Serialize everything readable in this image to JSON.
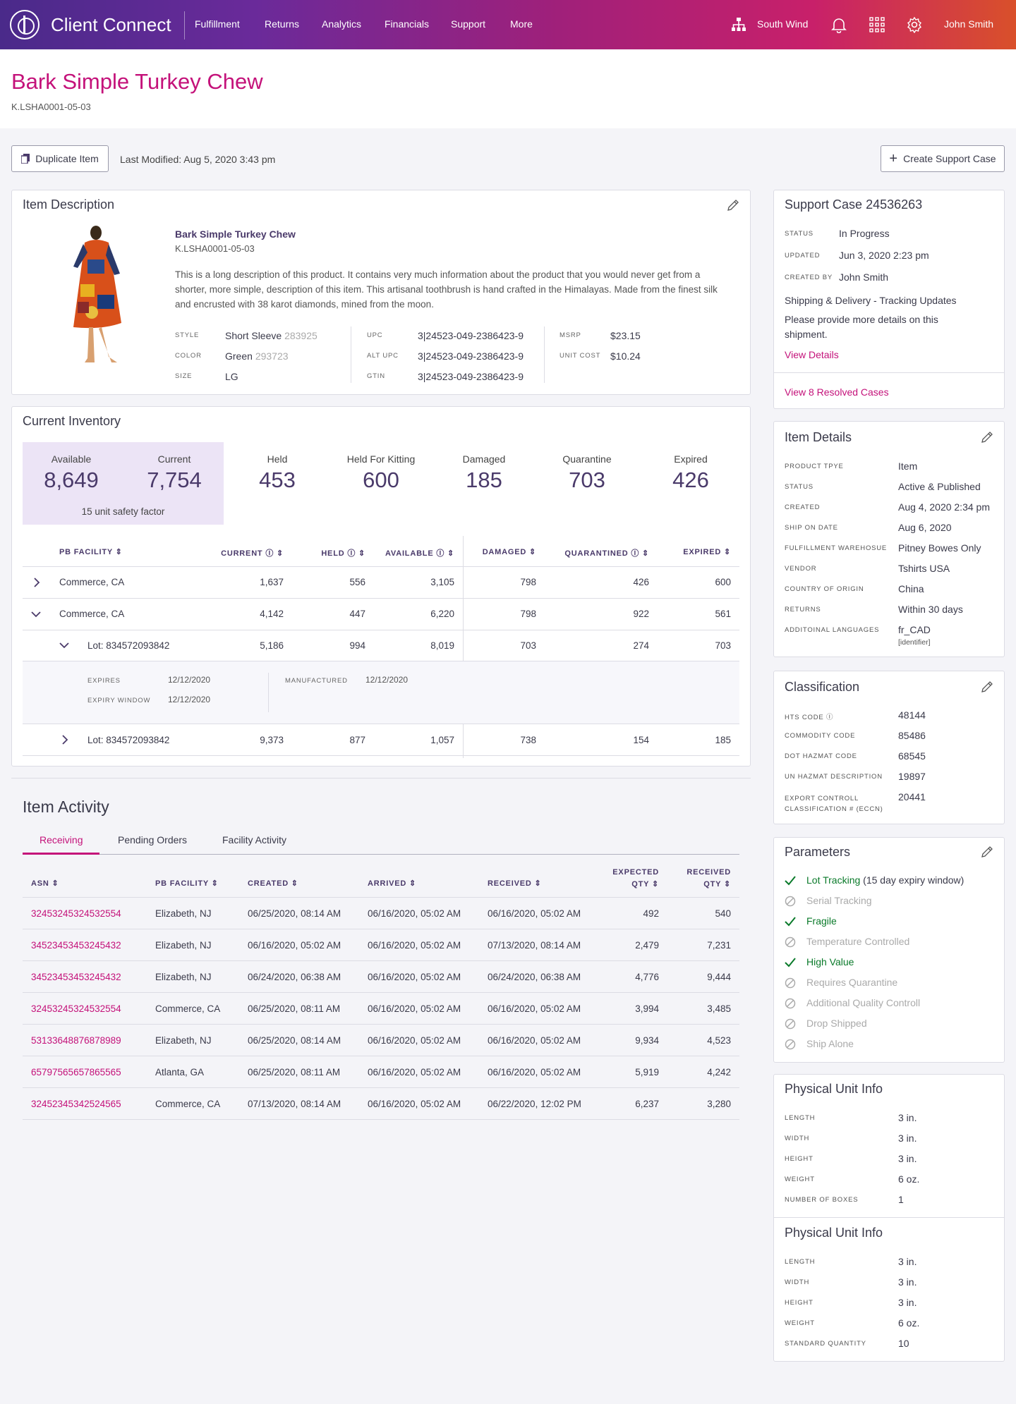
{
  "app": {
    "title": "Client Connect",
    "account": "South Wind",
    "user": "John Smith"
  },
  "nav": [
    "Fulfillment",
    "Returns",
    "Analytics",
    "Financials",
    "Support",
    "More"
  ],
  "page": {
    "title": "Bark Simple Turkey Chew",
    "sku": "K.LSHA0001-05-03"
  },
  "toolbar": {
    "duplicate_label": "Duplicate Item",
    "last_modified": "Last Modified: Aug 5, 2020  3:43 pm",
    "support_label": "Create Support Case"
  },
  "item_description": {
    "title": "Item Description",
    "name": "Bark Simple Turkey Chew",
    "sku": "K.LSHA0001-05-03",
    "text": "This is a long description of this product. It contains very much information about the product that you would never get from a shorter, more simple, description of this item. This artisanal toothbrush is hand crafted in the Himalayas. Made from the finest silk and encrusted with 38 karot diamonds, mined from the moon.",
    "style_label": "Style",
    "style": "Short Sleeve",
    "style_code": "283925",
    "color_label": "Color",
    "color": "Green",
    "color_code": "293723",
    "size_label": "Size",
    "size": "LG",
    "upc_label": "UPC",
    "upc": "3|24523-049-2386423-9",
    "alt_upc_label": "Alt UPC",
    "alt_upc": "3|24523-049-2386423-9",
    "gtin_label": "GTIN",
    "gtin": "3|24523-049-2386423-9",
    "msrp_label": "MSRP",
    "msrp": "$23.15",
    "unit_cost_label": "Unit Cost",
    "unit_cost": "$10.24"
  },
  "inventory": {
    "title": "Current Inventory",
    "stats": [
      {
        "label": "Available",
        "value": "8,649"
      },
      {
        "label": "Current",
        "value": "7,754"
      },
      {
        "label": "Held",
        "value": "453"
      },
      {
        "label": "Held For Kitting",
        "value": "600"
      },
      {
        "label": "Damaged",
        "value": "185"
      },
      {
        "label": "Quarantine",
        "value": "703"
      },
      {
        "label": "Expired",
        "value": "426"
      }
    ],
    "safety": "15 unit safety factor",
    "headers": [
      "PB Facility",
      "Current",
      "Held",
      "Available",
      "Damaged",
      "Quarantined",
      "Expired"
    ],
    "rows": [
      {
        "name": "Commerce, CA",
        "current": "1,637",
        "held": "556",
        "available": "3,105",
        "damaged": "798",
        "quarantined": "426",
        "expired": "600"
      },
      {
        "name": "Commerce, CA",
        "current": "4,142",
        "held": "447",
        "available": "6,220",
        "damaged": "798",
        "quarantined": "922",
        "expired": "561"
      },
      {
        "name": "Lot: 834572093842",
        "current": "5,186",
        "held": "994",
        "available": "8,019",
        "damaged": "703",
        "quarantined": "274",
        "expired": "703"
      },
      {
        "name": "Lot: 834572093842",
        "current": "9,373",
        "held": "877",
        "available": "1,057",
        "damaged": "738",
        "quarantined": "154",
        "expired": "185"
      }
    ],
    "lot_detail": {
      "expires_label": "Expires",
      "expires": "12/12/2020",
      "window_label": "Expiry Window",
      "window": "12/12/2020",
      "manufactured_label": "Manufactured",
      "manufactured": "12/12/2020"
    }
  },
  "activity": {
    "title": "Item Activity",
    "tabs": [
      "Receiving",
      "Pending Orders",
      "Facility Activity"
    ],
    "headers": [
      "ASN",
      "PB Facility",
      "Created",
      "Arrived",
      "Received",
      "Expected",
      "Qty",
      "Received",
      "Qty"
    ],
    "rows": [
      {
        "asn": "32453245324532554",
        "facility": "Elizabeth, NJ",
        "created": "06/25/2020, 08:14 AM",
        "arrived": "06/16/2020, 05:02 AM",
        "received": "06/16/2020, 05:02 AM",
        "expected_qty": "492",
        "received_qty": "540"
      },
      {
        "asn": "34523453453245432",
        "facility": "Elizabeth, NJ",
        "created": "06/16/2020, 05:02 AM",
        "arrived": "06/16/2020, 05:02 AM",
        "received": "07/13/2020, 08:14 AM",
        "expected_qty": "2,479",
        "received_qty": "7,231"
      },
      {
        "asn": "34523453453245432",
        "facility": "Elizabeth, NJ",
        "created": "06/24/2020,  06:38 AM",
        "arrived": "06/16/2020, 05:02 AM",
        "received": "06/24/2020,  06:38 AM",
        "expected_qty": "4,776",
        "received_qty": "9,444"
      },
      {
        "asn": "32453245324532554",
        "facility": "Commerce, CA",
        "created": "06/25/2020, 08:11 AM",
        "arrived": "06/16/2020, 05:02 AM",
        "received": "06/16/2020, 05:02 AM",
        "expected_qty": "3,994",
        "received_qty": "3,485"
      },
      {
        "asn": "53133648876878989",
        "facility": "Elizabeth, NJ",
        "created": "06/25/2020, 08:14 AM",
        "arrived": "06/16/2020, 05:02 AM",
        "received": "06/16/2020, 05:02 AM",
        "expected_qty": "9,934",
        "received_qty": "4,523"
      },
      {
        "asn": "65797565657865565",
        "facility": "Atlanta, GA",
        "created": "06/25/2020, 08:11 AM",
        "arrived": "06/16/2020, 05:02 AM",
        "received": "06/16/2020, 05:02 AM",
        "expected_qty": "5,919",
        "received_qty": "4,242"
      },
      {
        "asn": "32452345342524565",
        "facility": "Commerce, CA",
        "created": "07/13/2020, 08:14 AM",
        "arrived": "06/16/2020, 05:02 AM",
        "received": "06/22/2020, 12:02 PM",
        "expected_qty": "6,237",
        "received_qty": "3,280"
      }
    ]
  },
  "support_case": {
    "title": "Support Case 24536263",
    "fields": [
      {
        "label": "Status",
        "value": "In Progress"
      },
      {
        "label": "Updated",
        "value": "Jun 3, 2020  2:23 pm"
      },
      {
        "label": "Created By",
        "value": "John Smith"
      }
    ],
    "subject": "Shipping & Delivery - Tracking Updates",
    "message": "Please provide more details on this shipment.",
    "view_details": "View Details",
    "resolved": "View 8 Resolved Cases"
  },
  "item_details": {
    "title": "Item Details",
    "fields": [
      {
        "label": "Product Tpye",
        "value": "Item"
      },
      {
        "label": "Status",
        "value": "Active & Published"
      },
      {
        "label": "Created",
        "value": "Aug 4, 2020  2:34 pm"
      },
      {
        "label": "Ship On Date",
        "value": "Aug 6, 2020"
      },
      {
        "label": "Fulfillment Warehosue",
        "value": "Pitney Bowes Only"
      },
      {
        "label": "Vendor",
        "value": "Tshirts USA"
      },
      {
        "label": "Country Of Origin",
        "value": "China"
      },
      {
        "label": "Returns",
        "value": "Within 30 days"
      },
      {
        "label": "Additoinal Languages",
        "value": "fr_CAD"
      }
    ],
    "language_note": "[identifier]"
  },
  "classification": {
    "title": "Classification",
    "fields": [
      {
        "label": "HTS Code",
        "value": "48144"
      },
      {
        "label": "Commodity Code",
        "value": "85486"
      },
      {
        "label": "DOT Hazmat Code",
        "value": "68545"
      },
      {
        "label": "UN Hazmat Description",
        "value": "19897"
      },
      {
        "label": "Export Controll",
        "label2": "Classification # (ECCN)",
        "value": "20441"
      }
    ]
  },
  "parameters": {
    "title": "Parameters",
    "items": [
      {
        "label": "Lot Tracking",
        "suffix": " (15 day expiry window)",
        "on": true
      },
      {
        "label": "Serial Tracking",
        "suffix": "",
        "on": false
      },
      {
        "label": "Fragile",
        "suffix": "",
        "on": true
      },
      {
        "label": "Temperature Controlled",
        "suffix": "",
        "on": false
      },
      {
        "label": "High Value",
        "suffix": "",
        "on": true
      },
      {
        "label": "Requires Quarantine",
        "suffix": "",
        "on": false
      },
      {
        "label": "Additional Quality Controll",
        "suffix": "",
        "on": false
      },
      {
        "label": "Drop Shipped",
        "suffix": "",
        "on": false
      },
      {
        "label": "Ship Alone",
        "suffix": "",
        "on": false
      }
    ]
  },
  "physical_units": [
    {
      "title": "Physical Unit Info",
      "fields": [
        {
          "label": "Length",
          "value": "3 in."
        },
        {
          "label": "Width",
          "value": "3 in."
        },
        {
          "label": "Height",
          "value": "3 in."
        },
        {
          "label": "Weight",
          "value": "6 oz."
        },
        {
          "label": "Number Of Boxes",
          "value": "1"
        }
      ]
    },
    {
      "title": "Physical Unit Info",
      "fields": [
        {
          "label": "Length",
          "value": "3 in."
        },
        {
          "label": "Width",
          "value": "3 in."
        },
        {
          "label": "Height",
          "value": "3 in."
        },
        {
          "label": "Weight",
          "value": "6 oz."
        },
        {
          "label": "Standard Quantity",
          "value": "10"
        }
      ]
    }
  ],
  "colors": {
    "accent": "#c4127a",
    "stat_text": "#4a3a6a",
    "available_bg": "#ece4f6",
    "success": "#0a7a2a"
  }
}
